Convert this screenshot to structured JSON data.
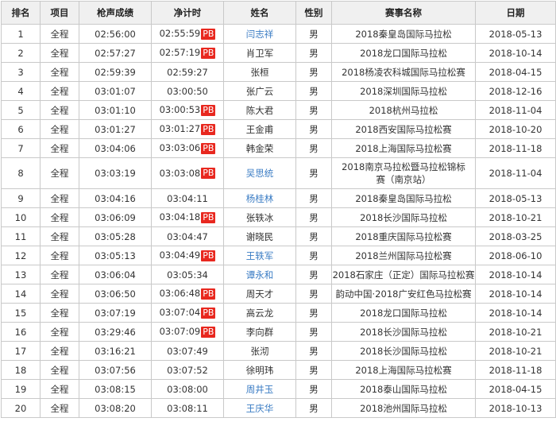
{
  "headers": [
    "排名",
    "项目",
    "枪声成绩",
    "净计时",
    "姓名",
    "性别",
    "赛事名称",
    "日期"
  ],
  "pb_label": "PB",
  "link_color": "#3a7cc4",
  "pb_color": "#e8281f",
  "rows": [
    {
      "rank": "1",
      "event": "全程",
      "gun": "02:56:00",
      "net": "02:55:59",
      "pb": true,
      "name": "闫志祥",
      "link": true,
      "gender": "男",
      "race": "2018秦皇岛国际马拉松",
      "date": "2018-05-13"
    },
    {
      "rank": "2",
      "event": "全程",
      "gun": "02:57:27",
      "net": "02:57:19",
      "pb": true,
      "name": "肖卫军",
      "link": false,
      "gender": "男",
      "race": "2018龙口国际马拉松",
      "date": "2018-10-14"
    },
    {
      "rank": "3",
      "event": "全程",
      "gun": "02:59:39",
      "net": "02:59:27",
      "pb": false,
      "name": "张桓",
      "link": false,
      "gender": "男",
      "race": "2018杨凌农科城国际马拉松赛",
      "date": "2018-04-15"
    },
    {
      "rank": "4",
      "event": "全程",
      "gun": "03:01:07",
      "net": "03:00:50",
      "pb": false,
      "name": "张广云",
      "link": false,
      "gender": "男",
      "race": "2018深圳国际马拉松",
      "date": "2018-12-16"
    },
    {
      "rank": "5",
      "event": "全程",
      "gun": "03:01:10",
      "net": "03:00:53",
      "pb": true,
      "name": "陈大君",
      "link": false,
      "gender": "男",
      "race": "2018杭州马拉松",
      "date": "2018-11-04"
    },
    {
      "rank": "6",
      "event": "全程",
      "gun": "03:01:27",
      "net": "03:01:27",
      "pb": true,
      "name": "王金甫",
      "link": false,
      "gender": "男",
      "race": "2018西安国际马拉松赛",
      "date": "2018-10-20"
    },
    {
      "rank": "7",
      "event": "全程",
      "gun": "03:04:06",
      "net": "03:03:06",
      "pb": true,
      "name": "韩金荣",
      "link": false,
      "gender": "男",
      "race": "2018上海国际马拉松赛",
      "date": "2018-11-18"
    },
    {
      "rank": "8",
      "event": "全程",
      "gun": "03:03:19",
      "net": "03:03:08",
      "pb": true,
      "name": "吴思统",
      "link": true,
      "gender": "男",
      "race": "2018南京马拉松暨马拉松锦标赛（南京站）",
      "date": "2018-11-04",
      "tall": true
    },
    {
      "rank": "9",
      "event": "全程",
      "gun": "03:04:16",
      "net": "03:04:11",
      "pb": false,
      "name": "杨桂林",
      "link": true,
      "gender": "男",
      "race": "2018秦皇岛国际马拉松",
      "date": "2018-05-13"
    },
    {
      "rank": "10",
      "event": "全程",
      "gun": "03:06:09",
      "net": "03:04:18",
      "pb": true,
      "name": "张轶冰",
      "link": false,
      "gender": "男",
      "race": "2018长沙国际马拉松",
      "date": "2018-10-21"
    },
    {
      "rank": "11",
      "event": "全程",
      "gun": "03:05:28",
      "net": "03:04:47",
      "pb": false,
      "name": "谢晓民",
      "link": false,
      "gender": "男",
      "race": "2018重庆国际马拉松赛",
      "date": "2018-03-25"
    },
    {
      "rank": "12",
      "event": "全程",
      "gun": "03:05:13",
      "net": "03:04:49",
      "pb": true,
      "name": "王轶军",
      "link": true,
      "gender": "男",
      "race": "2018兰州国际马拉松赛",
      "date": "2018-06-10"
    },
    {
      "rank": "13",
      "event": "全程",
      "gun": "03:06:04",
      "net": "03:05:34",
      "pb": false,
      "name": "谭永和",
      "link": true,
      "gender": "男",
      "race": "2018石家庄（正定）国际马拉松赛",
      "date": "2018-10-14"
    },
    {
      "rank": "14",
      "event": "全程",
      "gun": "03:06:50",
      "net": "03:06:48",
      "pb": true,
      "name": "周天才",
      "link": false,
      "gender": "男",
      "race": "韵动中国·2018广安红色马拉松赛",
      "date": "2018-10-14"
    },
    {
      "rank": "15",
      "event": "全程",
      "gun": "03:07:19",
      "net": "03:07:04",
      "pb": true,
      "name": "高云龙",
      "link": false,
      "gender": "男",
      "race": "2018龙口国际马拉松",
      "date": "2018-10-14"
    },
    {
      "rank": "16",
      "event": "全程",
      "gun": "03:29:46",
      "net": "03:07:09",
      "pb": true,
      "name": "李向群",
      "link": false,
      "gender": "男",
      "race": "2018长沙国际马拉松",
      "date": "2018-10-21"
    },
    {
      "rank": "17",
      "event": "全程",
      "gun": "03:16:21",
      "net": "03:07:49",
      "pb": false,
      "name": "张沏",
      "link": false,
      "gender": "男",
      "race": "2018长沙国际马拉松",
      "date": "2018-10-21"
    },
    {
      "rank": "18",
      "event": "全程",
      "gun": "03:07:56",
      "net": "03:07:52",
      "pb": false,
      "name": "徐明玮",
      "link": false,
      "gender": "男",
      "race": "2018上海国际马拉松赛",
      "date": "2018-11-18"
    },
    {
      "rank": "19",
      "event": "全程",
      "gun": "03:08:15",
      "net": "03:08:00",
      "pb": false,
      "name": "周井玉",
      "link": true,
      "gender": "男",
      "race": "2018泰山国际马拉松",
      "date": "2018-04-15"
    },
    {
      "rank": "20",
      "event": "全程",
      "gun": "03:08:20",
      "net": "03:08:11",
      "pb": false,
      "name": "王庆华",
      "link": true,
      "gender": "男",
      "race": "2018池州国际马拉松",
      "date": "2018-10-13"
    }
  ]
}
